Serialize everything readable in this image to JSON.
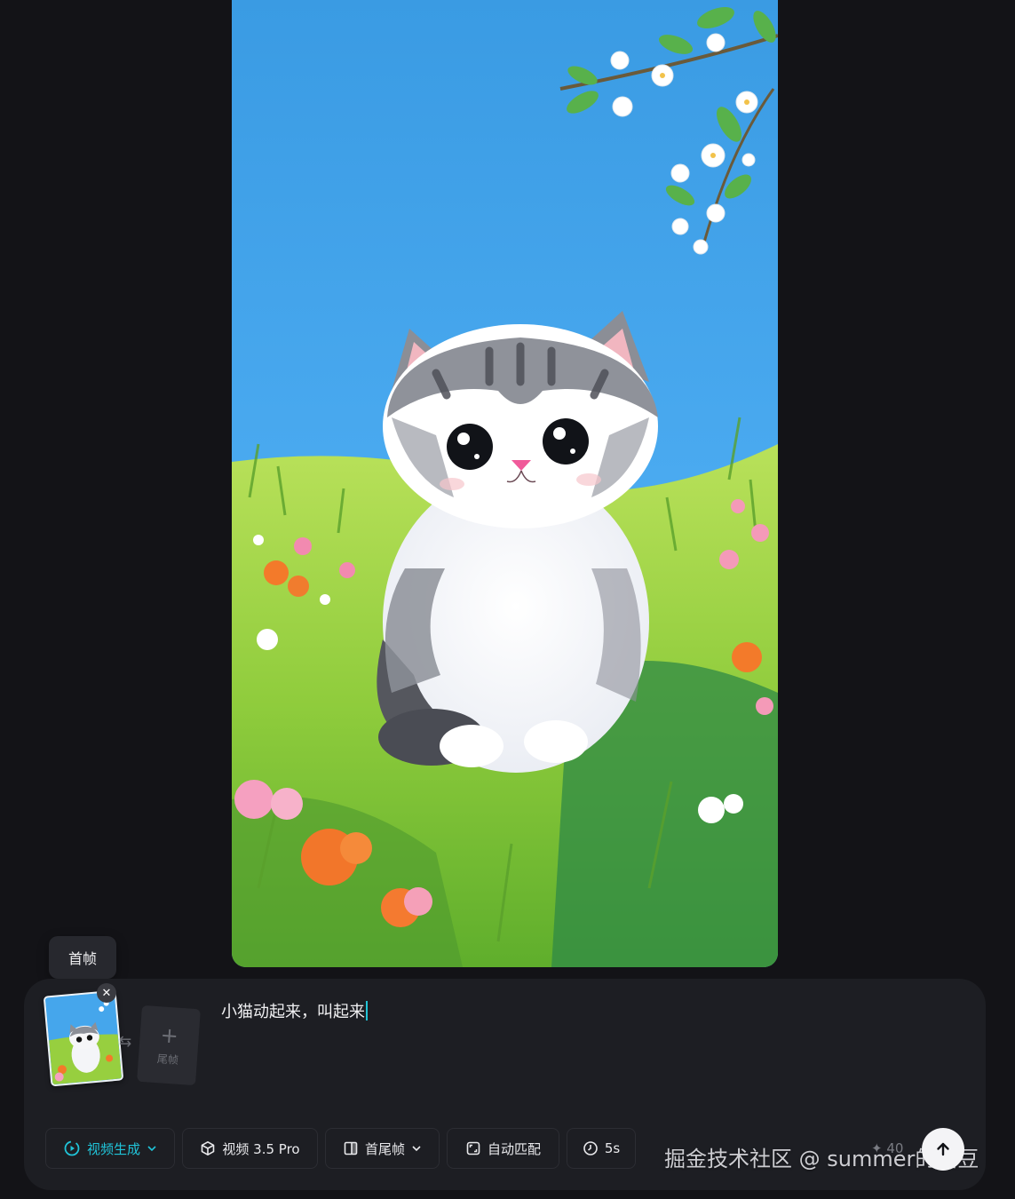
{
  "tooltip": {
    "text": "首帧"
  },
  "frames": {
    "start_frame": {
      "close_icon": "close-icon"
    },
    "swap_icon": "swap-arrows-icon",
    "end_frame": {
      "label": "尾帧"
    }
  },
  "prompt": {
    "text": "小猫动起来，叫起来"
  },
  "toolbar": {
    "mode": {
      "label": "视频生成"
    },
    "model": {
      "label": "视频 3.5 Pro"
    },
    "frame_mode": {
      "label": "首尾帧"
    },
    "ratio": {
      "label": "自动匹配"
    },
    "duration": {
      "label": "5s"
    },
    "credits": "40"
  },
  "watermark": "掘金技术社区 @ summer的甜豆",
  "colors": {
    "accent": "#20c4d9",
    "background": "#131317",
    "panel": "#1d1e23"
  }
}
